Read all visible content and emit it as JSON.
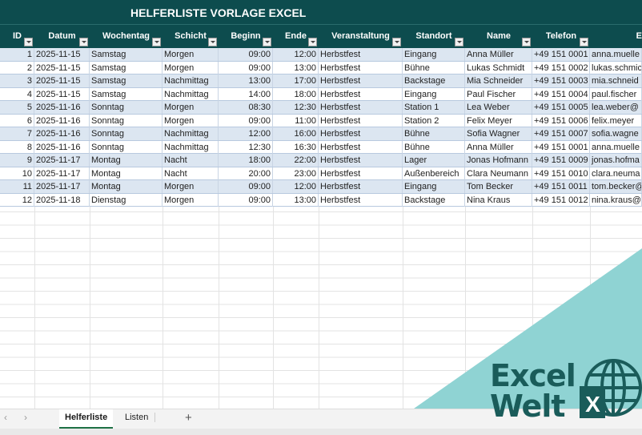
{
  "title": "HELFERLISTE VORLAGE EXCEL",
  "columns": [
    "ID",
    "Datum",
    "Wochentag",
    "Schicht",
    "Beginn",
    "Ende",
    "Veranstaltung",
    "Standort",
    "Name",
    "Telefon",
    "E"
  ],
  "rows": [
    [
      "1",
      "2025-11-15",
      "Samstag",
      "Morgen",
      "09:00",
      "12:00",
      "Herbstfest",
      "Eingang",
      "Anna Müller",
      "+49 151 0001",
      "anna.muelle"
    ],
    [
      "2",
      "2025-11-15",
      "Samstag",
      "Morgen",
      "09:00",
      "13:00",
      "Herbstfest",
      "Bühne",
      "Lukas Schmidt",
      "+49 151 0002",
      "lukas.schmic"
    ],
    [
      "3",
      "2025-11-15",
      "Samstag",
      "Nachmittag",
      "13:00",
      "17:00",
      "Herbstfest",
      "Backstage",
      "Mia Schneider",
      "+49 151 0003",
      "mia.schneid"
    ],
    [
      "4",
      "2025-11-15",
      "Samstag",
      "Nachmittag",
      "14:00",
      "18:00",
      "Herbstfest",
      "Eingang",
      "Paul Fischer",
      "+49 151 0004",
      "paul.fischer"
    ],
    [
      "5",
      "2025-11-16",
      "Sonntag",
      "Morgen",
      "08:30",
      "12:30",
      "Herbstfest",
      "Station 1",
      "Lea Weber",
      "+49 151 0005",
      "lea.weber@"
    ],
    [
      "6",
      "2025-11-16",
      "Sonntag",
      "Morgen",
      "09:00",
      "11:00",
      "Herbstfest",
      "Station 2",
      "Felix Meyer",
      "+49 151 0006",
      "felix.meyer"
    ],
    [
      "7",
      "2025-11-16",
      "Sonntag",
      "Nachmittag",
      "12:00",
      "16:00",
      "Herbstfest",
      "Bühne",
      "Sofia Wagner",
      "+49 151 0007",
      "sofia.wagne"
    ],
    [
      "8",
      "2025-11-16",
      "Sonntag",
      "Nachmittag",
      "12:30",
      "16:30",
      "Herbstfest",
      "Bühne",
      "Anna Müller",
      "+49 151 0001",
      "anna.muelle"
    ],
    [
      "9",
      "2025-11-17",
      "Montag",
      "Nacht",
      "18:00",
      "22:00",
      "Herbstfest",
      "Lager",
      "Jonas Hofmann",
      "+49 151 0009",
      "jonas.hofma"
    ],
    [
      "10",
      "2025-11-17",
      "Montag",
      "Nacht",
      "20:00",
      "23:00",
      "Herbstfest",
      "Außenbereich",
      "Clara Neumann",
      "+49 151 0010",
      "clara.neuma"
    ],
    [
      "11",
      "2025-11-17",
      "Montag",
      "Morgen",
      "09:00",
      "12:00",
      "Herbstfest",
      "Eingang",
      "Tom Becker",
      "+49 151 0011",
      "tom.becker@"
    ],
    [
      "12",
      "2025-11-18",
      "Dienstag",
      "Morgen",
      "09:00",
      "13:00",
      "Herbstfest",
      "Backstage",
      "Nina Kraus",
      "+49 151 0012",
      "nina.kraus@"
    ]
  ],
  "tabs": {
    "prev": "‹",
    "next": "›",
    "sheets": [
      "Helferliste",
      "Listen"
    ],
    "active": "Helferliste",
    "add": "+"
  },
  "logo": {
    "line1": "Excel",
    "line2": "Welt",
    "badge": "X"
  },
  "colors": {
    "header": "#0d4c4e",
    "band": "#dce6f1",
    "overlay": "#8fd3d3",
    "logo": "#1a5c5a"
  }
}
